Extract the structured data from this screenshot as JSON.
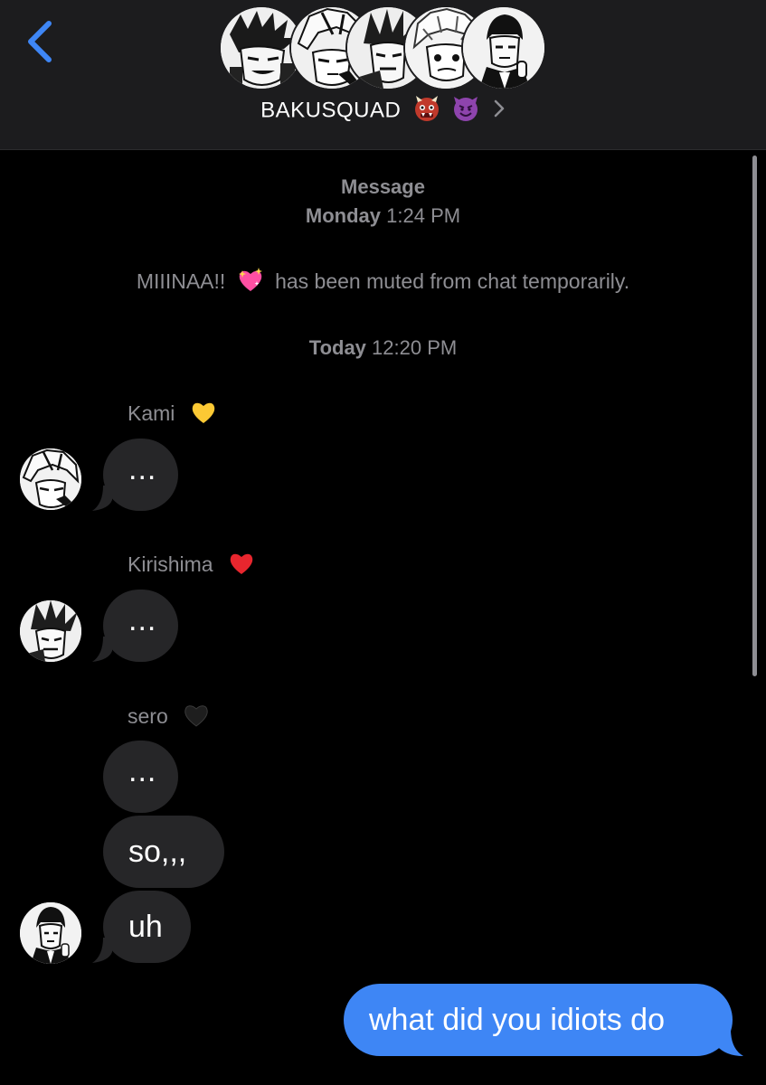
{
  "header": {
    "back_icon": "chevron-left-icon",
    "group_name": "BAKUSQUAD",
    "title_emojis": [
      "ogre-emoji",
      "smiling-imp-emoji"
    ],
    "details_icon": "chevron-right-icon",
    "member_avatars": [
      "member-avatar-1",
      "member-avatar-2",
      "member-avatar-3",
      "member-avatar-4",
      "member-avatar-5"
    ]
  },
  "conversation": {
    "earlier_label": "Message",
    "earlier_day": "Monday",
    "earlier_time": "1:24 PM",
    "system_note": {
      "name": "MIIINAA!!",
      "emoji": "sparkling-heart-emoji",
      "text": "has been muted from chat temporarily."
    },
    "today_day": "Today",
    "today_time": "12:20 PM",
    "messages": [
      {
        "sender": "Kami",
        "sender_emoji": "yellow-heart-emoji",
        "bubbles": [
          "..."
        ]
      },
      {
        "sender": "Kirishima",
        "sender_emoji": "red-heart-emoji",
        "bubbles": [
          "..."
        ]
      },
      {
        "sender": "sero",
        "sender_emoji": "black-heart-emoji",
        "bubbles": [
          "...",
          "so,,,",
          "uh"
        ]
      }
    ],
    "outgoing": "what did you idiots do"
  },
  "colors": {
    "background": "#000000",
    "header_background": "#1c1c1e",
    "incoming_bubble": "#262628",
    "outgoing_bubble": "#3e86f5",
    "meta_text": "#8e8e93",
    "accent": "#3e86f5"
  }
}
